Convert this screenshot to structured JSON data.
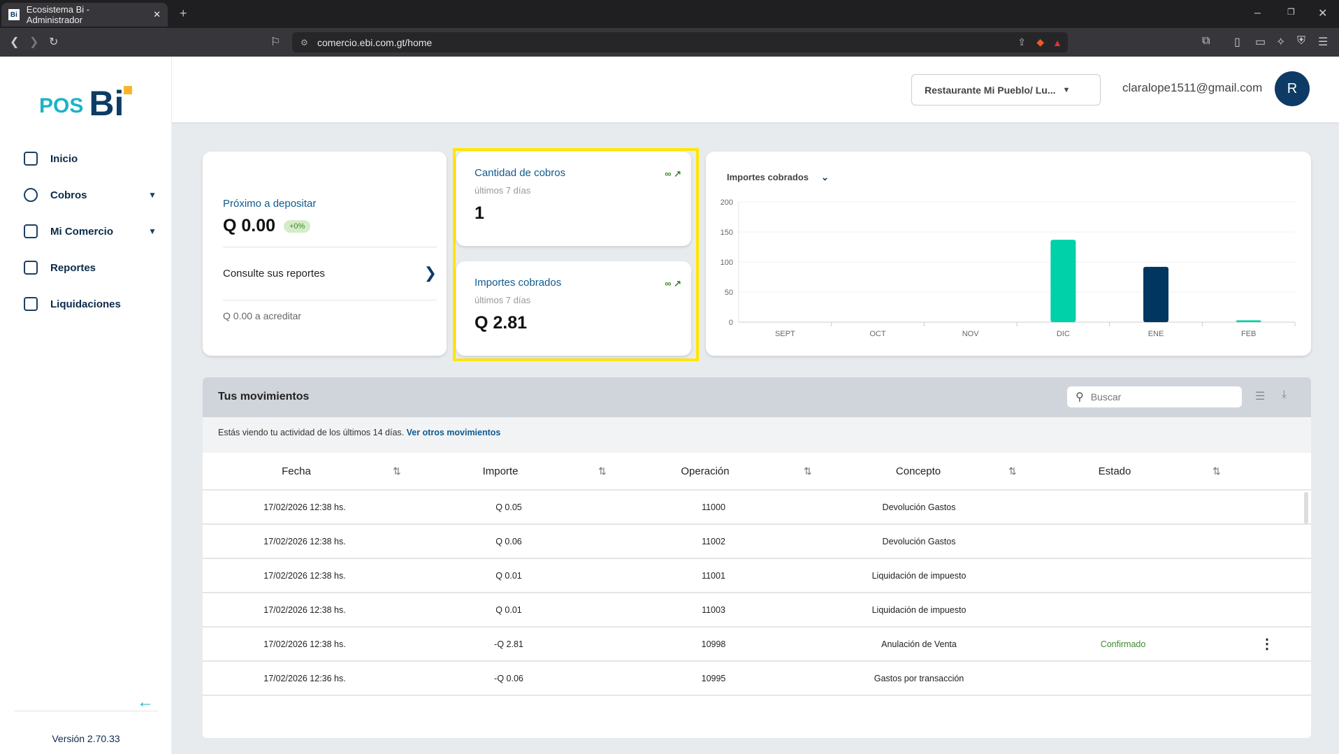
{
  "browser": {
    "tab_title": "Ecosistema Bi - Administrador",
    "favicon": "Bi",
    "url": "comercio.ebi.com.gt/home"
  },
  "sidebar": {
    "logo_pos": "POS",
    "logo_bi": "Bi",
    "items": [
      {
        "label": "Inicio",
        "icon": "home-icon"
      },
      {
        "label": "Cobros",
        "icon": "coin-icon",
        "has_submenu": true
      },
      {
        "label": "Mi Comercio",
        "icon": "store-icon",
        "has_submenu": true
      },
      {
        "label": "Reportes",
        "icon": "report-icon"
      },
      {
        "label": "Liquidaciones",
        "icon": "bank-icon"
      }
    ],
    "version": "Versión 2.70.33"
  },
  "header": {
    "store_select": "Restaurante Mi Pueblo/ Lu...",
    "email": "claralope1511@gmail.com",
    "avatar": "R"
  },
  "deposit_card": {
    "title": "Próximo a depositar",
    "amount": "Q 0.00",
    "badge": "+0%",
    "reports_link": "Consulte sus reportes",
    "to_credit": "Q 0.00 a acreditar"
  },
  "count_card": {
    "title": "Cantidad de cobros",
    "period": "últimos 7 días",
    "value": "1",
    "trend": "∞"
  },
  "amount_card": {
    "title": "Importes cobrados",
    "period": "últimos 7 días",
    "value": "Q 2.81",
    "trend": "∞"
  },
  "colors": {
    "accent": "#0e5b8e",
    "teal": "#00d1a8",
    "navy": "#00365f",
    "highlight": "#ffe600",
    "success": "#3a8a2a"
  },
  "chart_data": {
    "type": "bar",
    "title": "Importes cobrados",
    "categories": [
      "SEPT",
      "OCT",
      "NOV",
      "DIC",
      "ENE",
      "FEB"
    ],
    "values": [
      0,
      0,
      0,
      137,
      92,
      3
    ],
    "bar_colors": [
      "#00d1a8",
      "#00d1a8",
      "#00d1a8",
      "#00d1a8",
      "#00365f",
      "#00d1a8"
    ],
    "ylim": [
      0,
      200
    ],
    "yticks": [
      0,
      50,
      100,
      150,
      200
    ],
    "grid": true
  },
  "movements": {
    "title": "Tus movimientos",
    "search_placeholder": "Buscar",
    "info_text": "Estás viendo tu actividad de los últimos 14 días.",
    "info_link": "Ver otros movimientos",
    "columns": [
      "Fecha",
      "Importe",
      "Operación",
      "Concepto",
      "Estado"
    ],
    "rows": [
      {
        "fecha": "17/02/2026 12:38 hs.",
        "importe": "Q 0.05",
        "operacion": "11000",
        "concepto": "Devolución Gastos",
        "estado": ""
      },
      {
        "fecha": "17/02/2026 12:38 hs.",
        "importe": "Q 0.06",
        "operacion": "11002",
        "concepto": "Devolución Gastos",
        "estado": ""
      },
      {
        "fecha": "17/02/2026 12:38 hs.",
        "importe": "Q 0.01",
        "operacion": "11001",
        "concepto": "Liquidación de impuesto",
        "estado": ""
      },
      {
        "fecha": "17/02/2026 12:38 hs.",
        "importe": "Q 0.01",
        "operacion": "11003",
        "concepto": "Liquidación de impuesto",
        "estado": ""
      },
      {
        "fecha": "17/02/2026 12:38 hs.",
        "importe": "-Q 2.81",
        "operacion": "10998",
        "concepto": "Anulación de Venta",
        "estado": "Confirmado"
      },
      {
        "fecha": "17/02/2026 12:36 hs.",
        "importe": "-Q 0.06",
        "operacion": "10995",
        "concepto": "Gastos por transacción",
        "estado": ""
      }
    ]
  }
}
